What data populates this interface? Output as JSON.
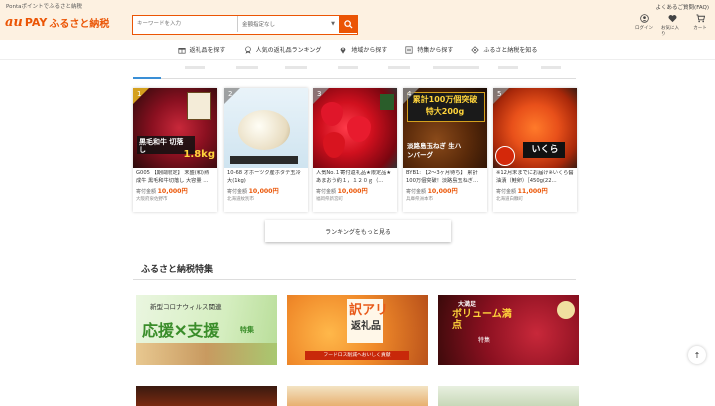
{
  "header": {
    "tagline": "Pontaポイントでふるさと納税",
    "logo_au": "au",
    "logo_pay": "PAY",
    "logo_name": "ふるさと納税",
    "search_placeholder": "キーワードを入力",
    "amount_select": "金額指定なし",
    "faq": "よくあるご質問(FAQ)",
    "tools": [
      {
        "icon": "user-icon",
        "label": "ログイン"
      },
      {
        "icon": "heart-icon",
        "label": "お気に入り"
      },
      {
        "icon": "cart-icon",
        "label": "カート"
      }
    ]
  },
  "nav": [
    {
      "icon": "gift-icon",
      "label": "返礼品を探す"
    },
    {
      "icon": "ranking-icon",
      "label": "人気の返礼品ランキング"
    },
    {
      "icon": "map-pin-icon",
      "label": "地域から探す"
    },
    {
      "icon": "feature-icon",
      "label": "特集から探す"
    },
    {
      "icon": "info-icon",
      "label": "ふるさと納税を知る"
    }
  ],
  "ranking": [
    {
      "rank": "1",
      "title": "G005 【期間限定】 末盛(和)熟成牛 黒毛和牛切落し 大容量 …",
      "price_label": "寄付金額",
      "price": "10,000円",
      "location": "大阪府泉佐野市",
      "img_text": "黒毛和牛 切落し",
      "img_badge": "1.8kg"
    },
    {
      "rank": "2",
      "title": "10-68 オホーツク産ホタテ玉冷大(1kg)",
      "price_label": "寄付金額",
      "price": "10,000円",
      "location": "北海道紋別市",
      "img_text": "",
      "img_badge": ""
    },
    {
      "rank": "3",
      "title": "人気No.１寄付返礼品★限定品★あまおう約１，１２０ｇ（…",
      "price_label": "寄付金額",
      "price": "10,000円",
      "location": "福岡県新宮町",
      "img_text": "",
      "img_badge": ""
    },
    {
      "rank": "4",
      "title": "BYB1: 【2～3ヶ月待ち】 累計100万個突破！淡路島玉ねぎ…",
      "price_label": "寄付金額",
      "price": "10,000円",
      "location": "兵庫県洲本市",
      "img_text": "淡路島玉ねぎ 生ハンバーグ",
      "img_badge": "累計100万個突破 特大200g"
    },
    {
      "rank": "5",
      "title": "※12月末までにお届け※いくら醤油漬（鮭卵）［450g(22…",
      "price_label": "寄付金額",
      "price": "11,000円",
      "location": "北海道白糠町",
      "img_text": "いくら",
      "img_badge": ""
    }
  ],
  "more_button": "ランキングをもっと見る",
  "section_title": "ふるさと納税特集",
  "banners": [
    {
      "top": "新型コロナウィルス関連",
      "main": "応援✕支援",
      "sub": "特集"
    },
    {
      "top": "訳アリ",
      "main": "返礼品",
      "sub": "フードロス削減へおいしく貢献"
    },
    {
      "top": "大満足",
      "main": "ボリューム満点",
      "sub": "特集"
    }
  ],
  "scroll_top": "↑",
  "colors": {
    "brand": "#eb5505",
    "header_bg": "#fdf1e1",
    "price": "#eb5505"
  }
}
